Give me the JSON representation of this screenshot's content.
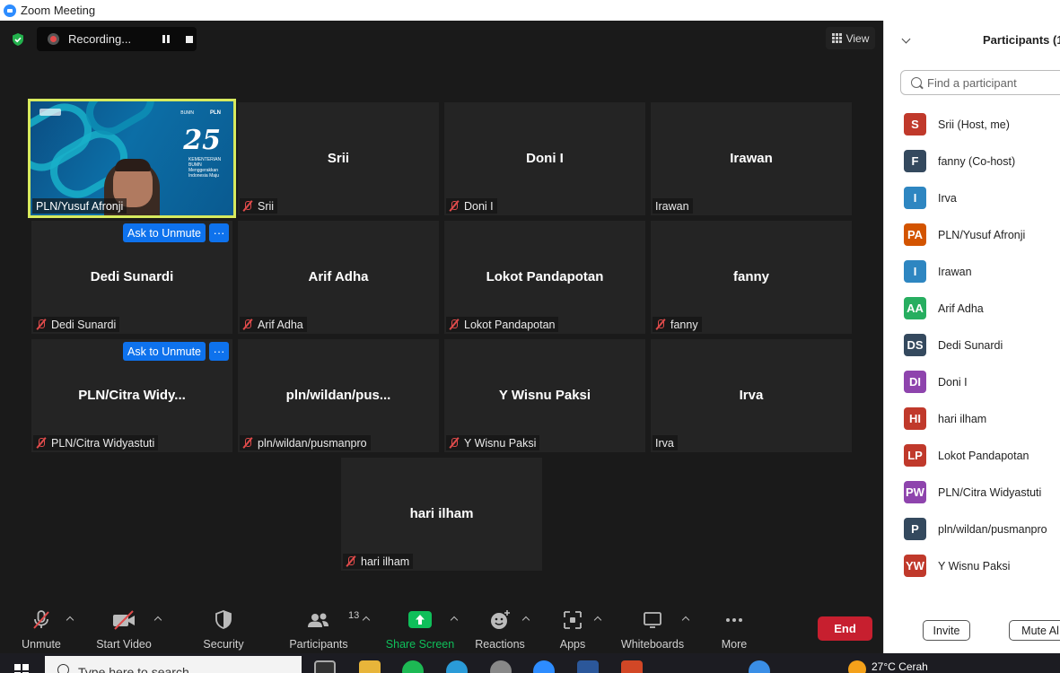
{
  "window": {
    "title": "Zoom Meeting"
  },
  "top": {
    "recording_label": "Recording...",
    "view_label": "View"
  },
  "video_tile": {
    "name": "PLN/Yusuf Afronji",
    "logo_text": "25",
    "brand": "PLN",
    "caption": "KEMENTERIAN BUMN Menggerakkan Indonesia Maju"
  },
  "tiles": [
    {
      "display": "Srii",
      "label": "Srii",
      "muted": true,
      "ask": false
    },
    {
      "display": "Doni I",
      "label": "Doni I",
      "muted": true,
      "ask": false
    },
    {
      "display": "Irawan",
      "label": "Irawan",
      "muted": false,
      "ask": false
    },
    {
      "display": "Dedi Sunardi",
      "label": "Dedi Sunardi",
      "muted": true,
      "ask": true
    },
    {
      "display": "Arif Adha",
      "label": "Arif Adha",
      "muted": true,
      "ask": false
    },
    {
      "display": "Lokot Pandapotan",
      "label": "Lokot Pandapotan",
      "muted": true,
      "ask": false
    },
    {
      "display": "fanny",
      "label": "fanny",
      "muted": true,
      "ask": false
    },
    {
      "display": "PLN/Citra  Widy...",
      "label": "PLN/Citra Widyastuti",
      "muted": true,
      "ask": true
    },
    {
      "display": "pln/wildan/pus...",
      "label": "pln/wildan/pusmanpro",
      "muted": true,
      "ask": false
    },
    {
      "display": "Y Wisnu Paksi",
      "label": "Y Wisnu Paksi",
      "muted": true,
      "ask": false
    },
    {
      "display": "Irva",
      "label": "Irva",
      "muted": false,
      "ask": false
    },
    {
      "display": "hari ilham",
      "label": "hari ilham",
      "muted": true,
      "ask": false
    }
  ],
  "ask_unmute_label": "Ask to Unmute",
  "more_label": "···",
  "toolbar": {
    "unmute": "Unmute",
    "start_video": "Start Video",
    "security": "Security",
    "participants": "Participants",
    "participants_count": "13",
    "share_screen": "Share Screen",
    "reactions": "Reactions",
    "apps": "Apps",
    "whiteboards": "Whiteboards",
    "more": "More",
    "end": "End"
  },
  "panel": {
    "title": "Participants (1",
    "search_placeholder": "Find a participant",
    "participants": [
      {
        "initials": "S",
        "name": "Srii (Host, me)",
        "color": "#c0392b"
      },
      {
        "initials": "F",
        "name": "fanny (Co-host)",
        "color": "#34495e"
      },
      {
        "initials": "I",
        "name": "Irva",
        "color": "#2e86c1"
      },
      {
        "initials": "PA",
        "name": "PLN/Yusuf Afronji",
        "color": "#d35400"
      },
      {
        "initials": "I",
        "name": "Irawan",
        "color": "#2e86c1"
      },
      {
        "initials": "AA",
        "name": "Arif Adha",
        "color": "#27ae60"
      },
      {
        "initials": "DS",
        "name": "Dedi Sunardi",
        "color": "#34495e"
      },
      {
        "initials": "DI",
        "name": "Doni I",
        "color": "#8e44ad"
      },
      {
        "initials": "HI",
        "name": "hari ilham",
        "color": "#c0392b"
      },
      {
        "initials": "LP",
        "name": "Lokot Pandapotan",
        "color": "#c0392b"
      },
      {
        "initials": "PW",
        "name": "PLN/Citra Widyastuti",
        "color": "#8e44ad"
      },
      {
        "initials": "P",
        "name": "pln/wildan/pusmanpro",
        "color": "#34495e"
      },
      {
        "initials": "YW",
        "name": "Y Wisnu Paksi",
        "color": "#c0392b"
      }
    ],
    "invite": "Invite",
    "mute_all": "Mute Al"
  },
  "taskbar": {
    "search_placeholder": "Type here to search",
    "weather": "27°C  Cerah"
  },
  "colors": {
    "accent": "#0e72ed",
    "end": "#c71f2f",
    "share": "#0fbf5a",
    "speaker_border": "#d7ea5e"
  }
}
